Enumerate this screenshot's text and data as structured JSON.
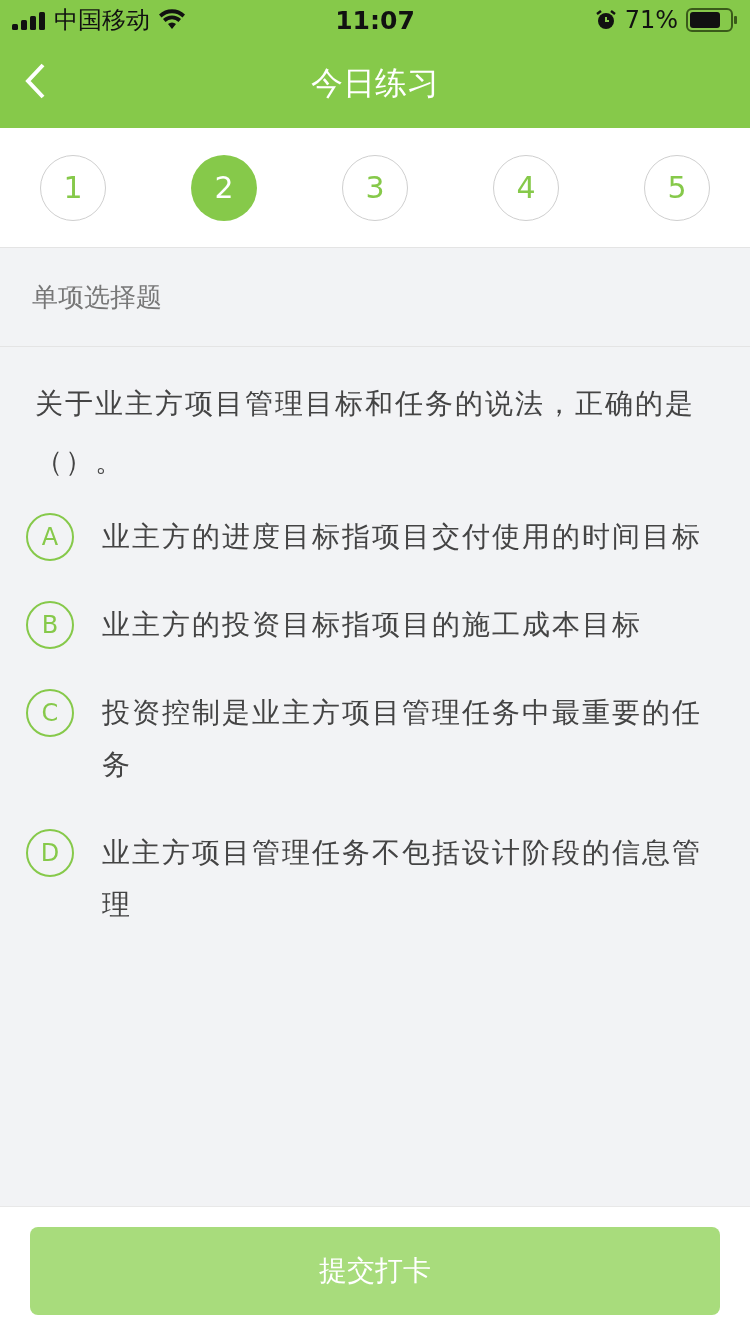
{
  "status_bar": {
    "carrier": "中国移动",
    "time": "11:07",
    "battery": "71%"
  },
  "nav": {
    "title": "今日练习"
  },
  "questions_nav": [
    {
      "label": "1",
      "selected": false
    },
    {
      "label": "2",
      "selected": true
    },
    {
      "label": "3",
      "selected": false
    },
    {
      "label": "4",
      "selected": false
    },
    {
      "label": "5",
      "selected": false
    }
  ],
  "question_type": "单项选择题",
  "question": "关于业主方项目管理目标和任务的说法，正确的是（）。",
  "options": [
    {
      "letter": "A",
      "text": "业主方的进度目标指项目交付使用的时间目标",
      "selected": false
    },
    {
      "letter": "B",
      "text": "业主方的投资目标指项目的施工成本目标",
      "selected": false
    },
    {
      "letter": "C",
      "text": "投资控制是业主方项目管理任务中最重要的任务",
      "selected": false
    },
    {
      "letter": "D",
      "text": "业主方项目管理任务不包括设计阶段的信息管理",
      "selected": false
    }
  ],
  "submit_button": {
    "label": "提交打卡",
    "disabled": true
  }
}
